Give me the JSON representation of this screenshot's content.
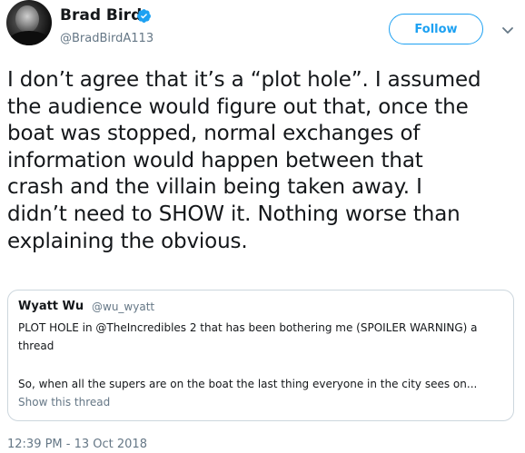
{
  "author": {
    "display_name": "Brad Bird",
    "handle": "@BradBirdA113",
    "verified": true
  },
  "follow_button": {
    "label": "Follow"
  },
  "tweet": {
    "text": "I don’t agree that it’s a “plot hole”. I assumed\nthe audience would figure out that, once the\nboat was stopped, normal exchanges of\ninformation would happen between that\ncrash and the villain being taken away. I\ndidn’t need to SHOW it. Nothing worse than\nexplaining the obvious.",
    "timestamp": "12:39 PM - 13 Oct 2018"
  },
  "quoted_tweet": {
    "display_name": "Wyatt Wu",
    "handle": "@wu_wyatt",
    "line1": "PLOT HOLE in @TheIncredibles 2 that has been bothering me (SPOILER WARNING) a",
    "line2": "thread",
    "line3": "So, when all the supers are on the boat the last thing everyone in the city sees on...",
    "show_thread_label": "Show this thread"
  },
  "colors": {
    "accent": "#1da1f2",
    "text": "#14171a",
    "secondary_text": "#657786",
    "border": "#ccd6dd"
  },
  "icons": {
    "verified": "verified-badge-icon",
    "caret": "chevron-down-icon"
  }
}
